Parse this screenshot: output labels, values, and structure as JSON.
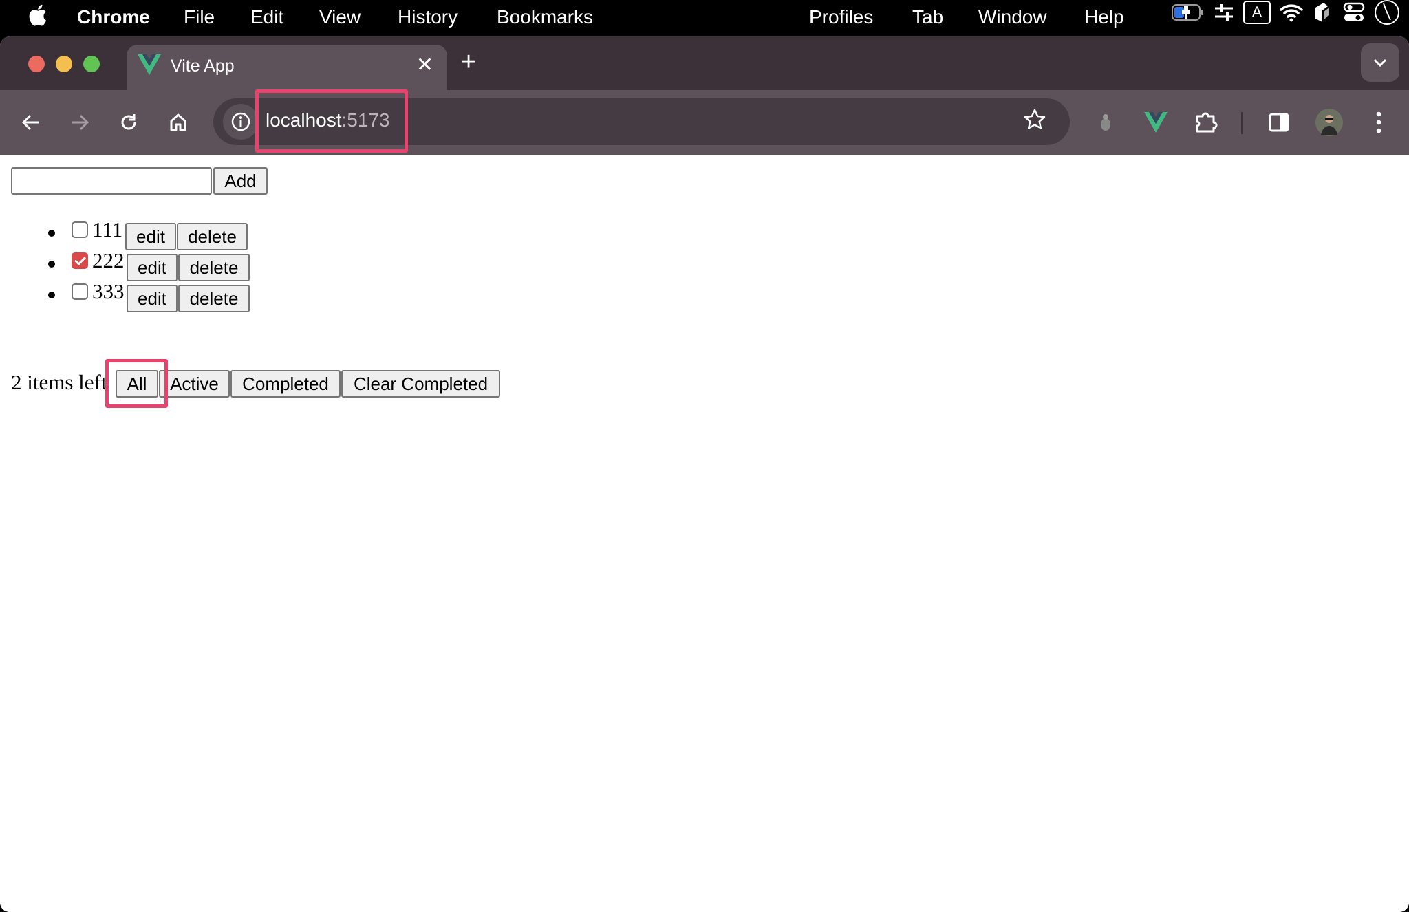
{
  "menubar": {
    "app": "Chrome",
    "items": [
      "File",
      "Edit",
      "View",
      "History",
      "Bookmarks",
      "Profiles",
      "Tab",
      "Window",
      "Help"
    ],
    "status_icons": [
      "battery-charging-icon",
      "control-sliders-icon",
      "input-source-icon",
      "wifi-icon",
      "app-shield-icon",
      "control-center-icon",
      "clock-icon"
    ],
    "input_source_label": "A"
  },
  "browser": {
    "tab": {
      "title": "Vite App",
      "favicon": "vue-logo-icon"
    },
    "address": {
      "host": "localhost",
      "port": ":5173"
    },
    "colors": {
      "highlight": "#e8426d",
      "tabstrip": "#3d3139",
      "toolbar": "#5e525a",
      "vue_green": "#42b883",
      "vue_dark": "#35495e"
    }
  },
  "app": {
    "new_todo": {
      "value": "",
      "placeholder": ""
    },
    "add_label": "Add",
    "todos": [
      {
        "text": "111",
        "done": false
      },
      {
        "text": "222",
        "done": true
      },
      {
        "text": "333",
        "done": false
      }
    ],
    "edit_label": "edit",
    "delete_label": "delete",
    "items_left": "2 items left",
    "filters": [
      "All",
      "Active",
      "Completed"
    ],
    "clear_label": "Clear Completed",
    "checkbox_color": "#d94a4a"
  }
}
